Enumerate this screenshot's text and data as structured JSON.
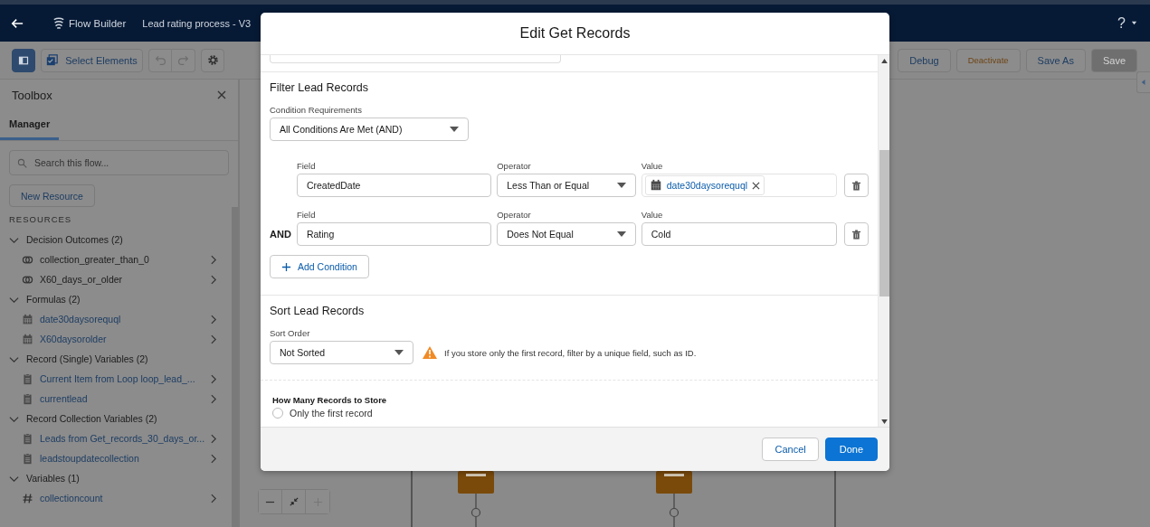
{
  "header": {
    "app_name": "Flow Builder",
    "flow_title": "Lead rating process - V3",
    "help": "?"
  },
  "toolbar": {
    "panel_toggle_selected": true,
    "select_elements": "Select Elements",
    "actions": [
      {
        "label": "Debug",
        "kind": "normal",
        "disabled": false
      },
      {
        "label": "Deactivate",
        "kind": "warning",
        "disabled": false
      },
      {
        "label": "Save As",
        "kind": "normal",
        "disabled": false
      },
      {
        "label": "Save",
        "kind": "normal",
        "disabled": true
      }
    ]
  },
  "toolbox": {
    "title": "Toolbox",
    "tabs": [
      {
        "label": "Manager",
        "selected": true
      }
    ],
    "search": {
      "placeholder": "Search this flow..."
    },
    "new_resource": "New Resource",
    "resources_heading": "RESOURCES",
    "groups": [
      {
        "label": "Decision Outcomes (2)",
        "expanded": true,
        "children": [
          {
            "label": "collection_greater_than_0",
            "kind": "outcome"
          },
          {
            "label": "X60_days_or_older",
            "kind": "outcome"
          }
        ]
      },
      {
        "label": "Formulas (2)",
        "expanded": true,
        "children": [
          {
            "label": "date30daysorequql",
            "kind": "formula"
          },
          {
            "label": "X60daysorolder",
            "kind": "formula"
          }
        ]
      },
      {
        "label": "Record (Single) Variables (2)",
        "expanded": true,
        "children": [
          {
            "label": "Current Item from Loop loop_lead_...",
            "kind": "record"
          },
          {
            "label": "currentlead",
            "kind": "record"
          }
        ]
      },
      {
        "label": "Record Collection Variables (2)",
        "expanded": true,
        "children": [
          {
            "label": "Leads from Get_records_30_days_or...",
            "kind": "record"
          },
          {
            "label": "leadstoupdatecollection",
            "kind": "record"
          }
        ]
      },
      {
        "label": "Variables (1)",
        "expanded": true,
        "children": [
          {
            "label": "collectioncount",
            "kind": "number"
          }
        ]
      }
    ]
  },
  "modal": {
    "title": "Edit Get Records",
    "filter": {
      "heading": "Filter Lead Records",
      "requirements_label": "Condition Requirements",
      "requirements_value": "All Conditions Are Met (AND)",
      "conditions": [
        {
          "field_label": "Field",
          "field": "CreatedDate",
          "operator_label": "Operator",
          "operator": "Less Than or Equal",
          "value_label": "Value",
          "value": "date30daysorequql",
          "kind": "resource"
        },
        {
          "connector": "AND",
          "field_label": "Field",
          "field": "Rating",
          "operator_label": "Operator",
          "operator": "Does Not Equal",
          "value_label": "Value",
          "value": "Cold",
          "kind": "text"
        }
      ],
      "add_condition": "Add Condition"
    },
    "sort": {
      "heading": "Sort Lead Records",
      "order_label": "Sort Order",
      "order_value": "Not Sorted",
      "warning": "If you store only the first record, filter by a unique field, such as ID."
    },
    "store": {
      "heading": "How Many Records to Store",
      "options": [
        {
          "label": "Only the first record",
          "selected": false
        }
      ]
    },
    "buttons": [
      {
        "label": "Cancel",
        "kind": "neutral"
      },
      {
        "label": "Done",
        "kind": "brand"
      }
    ]
  }
}
